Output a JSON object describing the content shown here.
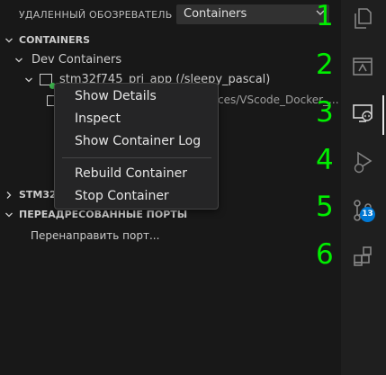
{
  "sidebar": {
    "title": "УДАЛЕННЫЙ ОБОЗРЕВАТЕЛЬ",
    "selector_value": "Containers"
  },
  "containers_section": {
    "header": "CONTAINERS",
    "group": "Dev Containers",
    "container_name": "stm32f745_pri_app (/sleepy_pascal)",
    "folder_path": "ces/VScode_Docker_..."
  },
  "stm32_section": {
    "header": "STM32"
  },
  "ports_section": {
    "header": "ПЕРЕАДРЕСОВАННЫЕ ПОРТЫ",
    "forward_link": "Перенаправить порт..."
  },
  "context_menu": {
    "items": [
      "Show Details",
      "Inspect",
      "Show Container Log",
      "Rebuild Container",
      "Stop Container"
    ]
  },
  "activity_bar": {
    "icons": [
      "explorer-icon",
      "remote-explorer-icon",
      "remote-monitor-icon",
      "run-debug-icon",
      "source-control-icon",
      "extensions-icon"
    ],
    "badge_count": "13"
  },
  "annotations": [
    "1",
    "2",
    "3",
    "4",
    "5",
    "6"
  ],
  "colors": {
    "sidebar_bg": "#181818",
    "menu_bg": "#252526",
    "annotation_green": "#00ee00",
    "badge_blue": "#0078d4",
    "status_green": "#3fb950"
  }
}
